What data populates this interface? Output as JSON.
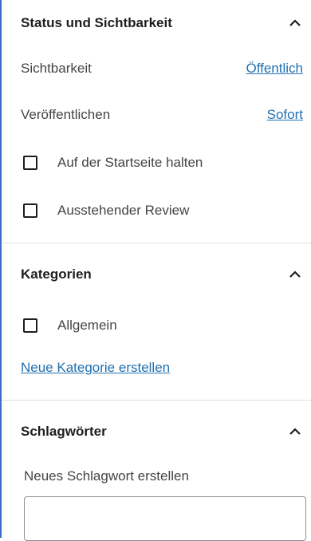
{
  "status_panel": {
    "title": "Status und Sichtbarkeit",
    "visibility_label": "Sichtbarkeit",
    "visibility_value": "Öffentlich",
    "publish_label": "Veröffentlichen",
    "publish_value": "Sofort",
    "sticky_label": "Auf der Startseite halten",
    "pending_label": "Ausstehender Review"
  },
  "categories_panel": {
    "title": "Kategorien",
    "items": [
      {
        "label": "Allgemein",
        "checked": false
      }
    ],
    "add_new_link": "Neue Kategorie erstellen"
  },
  "tags_panel": {
    "title": "Schlagwörter",
    "field_label": "Neues Schlagwort erstellen",
    "input_value": ""
  },
  "colors": {
    "link": "#2271b1",
    "accent_border": "#3a6fc4",
    "divider": "#e0e0e0"
  },
  "icons": {
    "collapse": "chevron-up-icon"
  }
}
